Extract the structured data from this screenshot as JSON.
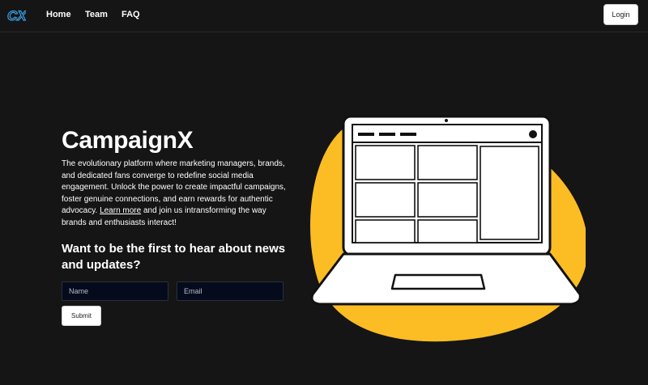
{
  "nav": {
    "logo_text": "CX",
    "links": [
      "Home",
      "Team",
      "FAQ"
    ],
    "login_label": "Login"
  },
  "hero": {
    "title": "CampaignX",
    "description_part1": "The evolutionary platform where marketing managers, brands, and dedicated fans converge to redefine social media engagement. Unlock the power to create impactful campaigns, foster genuine connections, and earn rewards for authentic advocacy. ",
    "learn_more": "Learn more",
    "description_part2": " and join us intransforming the way brands and enthusiasts interact!",
    "signup_heading": "Want to be the first to hear about news and updates?"
  },
  "form": {
    "name_placeholder": "Name",
    "email_placeholder": "Email",
    "submit_label": "Submit"
  },
  "colors": {
    "background": "#151515",
    "accent_yellow": "#fbbd23",
    "logo_blue": "#3aa0e6",
    "input_bg": "#050b1d"
  },
  "icons": {
    "logo": "campaignx-logo-icon",
    "illustration": "laptop-illustration"
  }
}
